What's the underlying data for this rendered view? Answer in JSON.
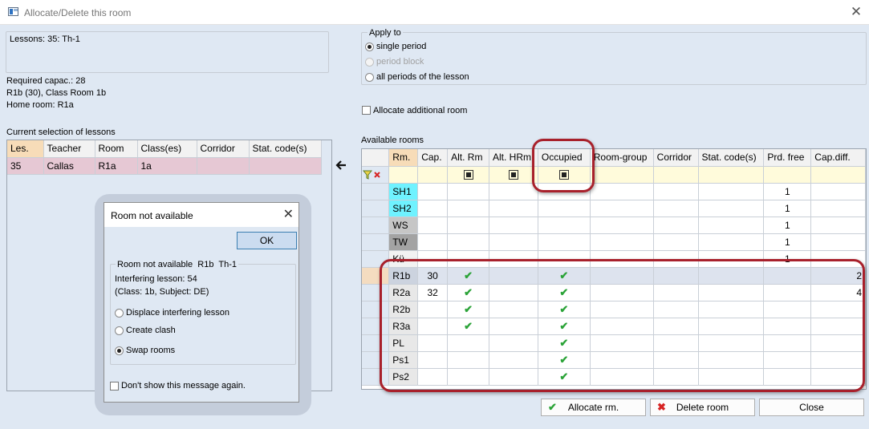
{
  "window": {
    "title": "Allocate/Delete this room",
    "close": "✕"
  },
  "lesson_info": {
    "summary": "Lessons: 35: Th-1",
    "required_capac": "Required capac.: 28",
    "room_line": "R1b (30), Class Room 1b",
    "home_room": "Home room: R1a"
  },
  "apply_to": {
    "label": "Apply to",
    "options": [
      {
        "label": "single period",
        "checked": true,
        "disabled": false
      },
      {
        "label": "period block",
        "checked": false,
        "disabled": true
      },
      {
        "label": "all periods of the lesson",
        "checked": false,
        "disabled": false
      }
    ]
  },
  "allocate_additional": {
    "label": "Allocate additional room",
    "checked": false
  },
  "current_selection": {
    "label": "Current selection of lessons",
    "columns": [
      "Les.",
      "Teacher",
      "Room",
      "Class(es)",
      "Corridor",
      "Stat. code(s)"
    ],
    "rows": [
      [
        "35",
        "Callas",
        "R1a",
        "1a",
        "",
        ""
      ]
    ]
  },
  "available_rooms": {
    "label": "Available rooms",
    "columns": [
      "Rm.",
      "Cap.",
      "Alt. Rm",
      "Alt. HRm",
      "Occupied",
      "Room-group",
      "Corridor",
      "Stat. code(s)",
      "Prd. free",
      "Cap.diff."
    ],
    "rows": [
      {
        "rm": "SH1",
        "cap": "",
        "alt_rm": false,
        "occupied": false,
        "prd_free": "1",
        "cap_diff": "",
        "color": "#6ff2ff"
      },
      {
        "rm": "SH2",
        "cap": "",
        "alt_rm": false,
        "occupied": false,
        "prd_free": "1",
        "cap_diff": "",
        "color": "#6ff2ff"
      },
      {
        "rm": "WS",
        "cap": "",
        "alt_rm": false,
        "occupied": false,
        "prd_free": "1",
        "cap_diff": "",
        "color": "#c6c6c6"
      },
      {
        "rm": "TW",
        "cap": "",
        "alt_rm": false,
        "occupied": false,
        "prd_free": "1",
        "cap_diff": "",
        "color": "#a3a3a3"
      },
      {
        "rm": "Kü",
        "cap": "",
        "alt_rm": false,
        "occupied": false,
        "prd_free": "1",
        "cap_diff": "",
        "color": "#f2f2f2"
      },
      {
        "rm": "R1b",
        "cap": "30",
        "alt_rm": true,
        "occupied": true,
        "prd_free": "",
        "cap_diff": "2",
        "color": ""
      },
      {
        "rm": "R2a",
        "cap": "32",
        "alt_rm": true,
        "occupied": true,
        "prd_free": "",
        "cap_diff": "4",
        "color": ""
      },
      {
        "rm": "R2b",
        "cap": "",
        "alt_rm": true,
        "occupied": true,
        "prd_free": "",
        "cap_diff": "",
        "color": ""
      },
      {
        "rm": "R3a",
        "cap": "",
        "alt_rm": true,
        "occupied": true,
        "prd_free": "",
        "cap_diff": "",
        "color": ""
      },
      {
        "rm": "PL",
        "cap": "",
        "alt_rm": false,
        "occupied": true,
        "prd_free": "",
        "cap_diff": "",
        "color": ""
      },
      {
        "rm": "Ps1",
        "cap": "",
        "alt_rm": false,
        "occupied": true,
        "prd_free": "",
        "cap_diff": "",
        "color": ""
      },
      {
        "rm": "Ps2",
        "cap": "",
        "alt_rm": false,
        "occupied": true,
        "prd_free": "",
        "cap_diff": "",
        "color": ""
      }
    ]
  },
  "buttons": {
    "allocate": "Allocate rm.",
    "delete": "Delete room",
    "close": "Close"
  },
  "popup": {
    "title": "Room not available",
    "ok": "OK",
    "group_label": "Room not available  R1b  Th-1",
    "interfering": "Interfering lesson: 54",
    "class_subject": "(Class: 1b, Subject: DE)",
    "options": [
      {
        "label": "Displace interfering lesson",
        "checked": false
      },
      {
        "label": "Create clash",
        "checked": false
      },
      {
        "label": "Swap rooms",
        "checked": true
      }
    ],
    "dont_show": "Don't show this message again."
  },
  "colors": {
    "accent_highlight": "#a8202b",
    "check_green": "#2ba338",
    "delete_red": "#d72323"
  }
}
